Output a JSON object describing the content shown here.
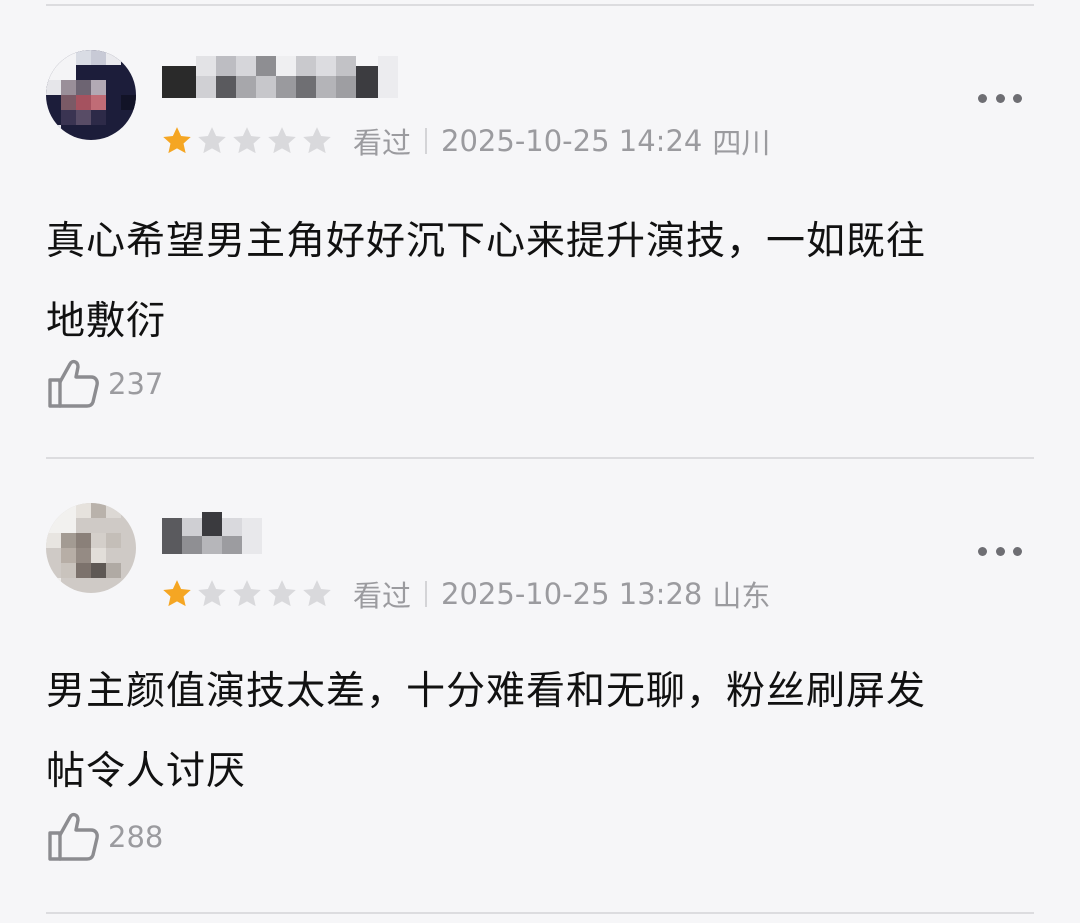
{
  "colors": {
    "background": "#f6f6f8",
    "star_active": "#f5a623",
    "star_inactive": "#d9d9dc",
    "secondary_text": "#9b9b9f",
    "primary_text": "#111111"
  },
  "reviews": [
    {
      "user": {
        "avatar_icon": "pixelated-avatar",
        "name_icon": "pixelated-username"
      },
      "rating": {
        "value": 1,
        "max": 5
      },
      "watched_label": "看过",
      "datetime": "2025-10-25 14:24",
      "region": "四川",
      "content": "真心希望男主角好好沉下心来提升演技，一如既往\n地敷衍",
      "like_icon": "thumbs-up-icon",
      "likes": "237",
      "more_icon": "more-horizontal-icon"
    },
    {
      "user": {
        "avatar_icon": "pixelated-avatar",
        "name_icon": "pixelated-username"
      },
      "rating": {
        "value": 1,
        "max": 5
      },
      "watched_label": "看过",
      "datetime": "2025-10-25 13:28",
      "region": "山东",
      "content": "男主颜值演技太差，十分难看和无聊，粉丝刷屏发\n帖令人讨厌",
      "like_icon": "thumbs-up-icon",
      "likes": "288",
      "more_icon": "more-horizontal-icon"
    }
  ]
}
